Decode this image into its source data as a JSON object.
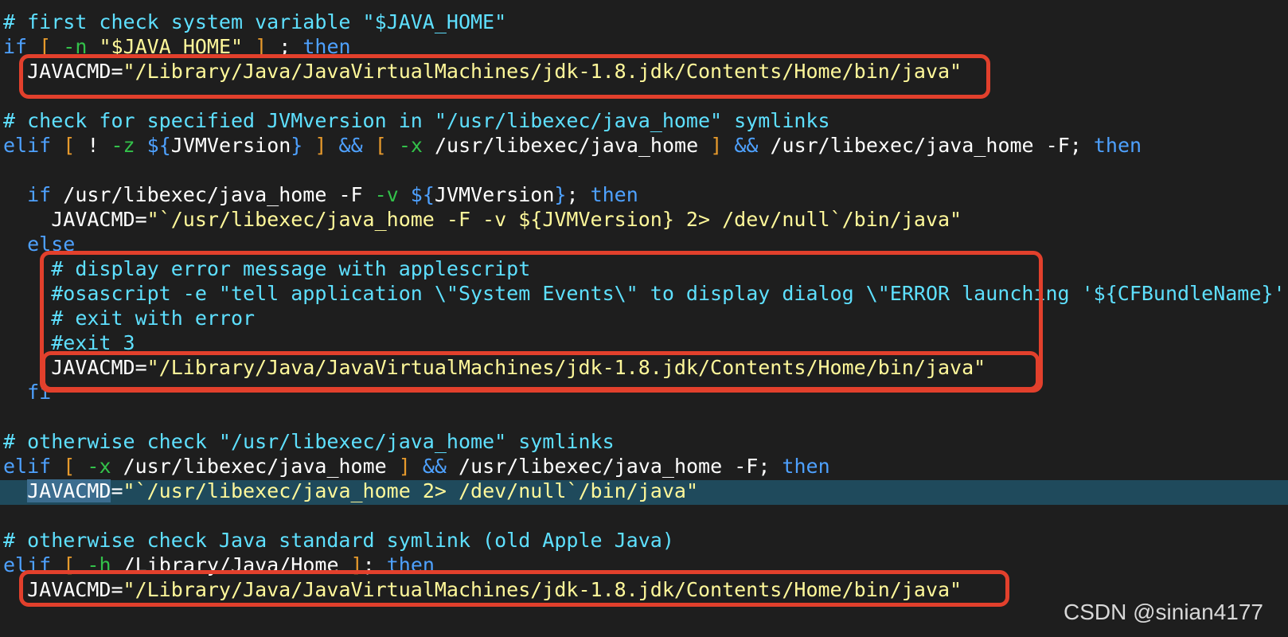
{
  "editor": {
    "lines": [
      {
        "segments": [
          {
            "t": "comment",
            "text": "# first check system variable \"$JAVA_HOME\""
          }
        ]
      },
      {
        "segments": [
          {
            "t": "kw",
            "text": "if"
          },
          {
            "t": "plain",
            "text": " "
          },
          {
            "t": "bracket",
            "text": "["
          },
          {
            "t": "plain",
            "text": " "
          },
          {
            "t": "test",
            "text": "-n"
          },
          {
            "t": "plain",
            "text": " "
          },
          {
            "t": "str",
            "text": "\"$JAVA_HOME\""
          },
          {
            "t": "plain",
            "text": " "
          },
          {
            "t": "bracket",
            "text": "]"
          },
          {
            "t": "plain",
            "text": " ; "
          },
          {
            "t": "kw",
            "text": "then"
          }
        ]
      },
      {
        "segments": [
          {
            "t": "plain",
            "text": "  JAVACMD="
          },
          {
            "t": "str",
            "text": "\"/Library/Java/JavaVirtualMachines/jdk-1.8.jdk/Contents/Home/bin/java\""
          }
        ]
      },
      {
        "segments": []
      },
      {
        "segments": [
          {
            "t": "comment",
            "text": "# check for specified JVMversion in \"/usr/libexec/java_home\" symlinks"
          }
        ]
      },
      {
        "segments": [
          {
            "t": "kw",
            "text": "elif"
          },
          {
            "t": "plain",
            "text": " "
          },
          {
            "t": "bracket",
            "text": "["
          },
          {
            "t": "plain",
            "text": " ! "
          },
          {
            "t": "test",
            "text": "-z"
          },
          {
            "t": "plain",
            "text": " "
          },
          {
            "t": "var",
            "text": "${"
          },
          {
            "t": "plain",
            "text": "JVMVersion"
          },
          {
            "t": "var",
            "text": "}"
          },
          {
            "t": "plain",
            "text": " "
          },
          {
            "t": "bracket",
            "text": "]"
          },
          {
            "t": "plain",
            "text": " "
          },
          {
            "t": "kw",
            "text": "&&"
          },
          {
            "t": "plain",
            "text": " "
          },
          {
            "t": "bracket",
            "text": "["
          },
          {
            "t": "plain",
            "text": " "
          },
          {
            "t": "test",
            "text": "-x"
          },
          {
            "t": "plain",
            "text": " /usr/libexec/java_home "
          },
          {
            "t": "bracket",
            "text": "]"
          },
          {
            "t": "plain",
            "text": " "
          },
          {
            "t": "kw",
            "text": "&&"
          },
          {
            "t": "plain",
            "text": " /usr/libexec/java_home -F; "
          },
          {
            "t": "kw",
            "text": "then"
          }
        ]
      },
      {
        "segments": []
      },
      {
        "segments": [
          {
            "t": "plain",
            "text": "  "
          },
          {
            "t": "kw",
            "text": "if"
          },
          {
            "t": "plain",
            "text": " /usr/libexec/java_home -F "
          },
          {
            "t": "test",
            "text": "-v"
          },
          {
            "t": "plain",
            "text": " "
          },
          {
            "t": "var",
            "text": "${"
          },
          {
            "t": "plain",
            "text": "JVMVersion"
          },
          {
            "t": "var",
            "text": "}"
          },
          {
            "t": "plain",
            "text": "; "
          },
          {
            "t": "kw",
            "text": "then"
          }
        ]
      },
      {
        "segments": [
          {
            "t": "plain",
            "text": "    JAVACMD="
          },
          {
            "t": "str",
            "text": "\"`/usr/libexec/java_home -F -v ${JVMVersion} 2> /dev/null`/bin/java\""
          }
        ]
      },
      {
        "segments": [
          {
            "t": "plain",
            "text": "  "
          },
          {
            "t": "kw",
            "text": "else"
          }
        ]
      },
      {
        "segments": [
          {
            "t": "plain",
            "text": "    "
          },
          {
            "t": "comment",
            "text": "# display error message with applescript"
          }
        ]
      },
      {
        "segments": [
          {
            "t": "plain",
            "text": "    "
          },
          {
            "t": "comment",
            "text": "#osascript -e \"tell application \\\"System Events\\\" to display dialog \\\"ERROR launching '${CFBundleName}'"
          }
        ]
      },
      {
        "segments": [
          {
            "t": "plain",
            "text": "    "
          },
          {
            "t": "comment",
            "text": "# exit with error"
          }
        ]
      },
      {
        "segments": [
          {
            "t": "plain",
            "text": "    "
          },
          {
            "t": "comment",
            "text": "#exit 3"
          }
        ]
      },
      {
        "segments": [
          {
            "t": "plain",
            "text": "    JAVACMD="
          },
          {
            "t": "str",
            "text": "\"/Library/Java/JavaVirtualMachines/jdk-1.8.jdk/Contents/Home/bin/java\""
          }
        ]
      },
      {
        "segments": [
          {
            "t": "plain",
            "text": "  "
          },
          {
            "t": "kw",
            "text": "fi"
          }
        ]
      },
      {
        "segments": []
      },
      {
        "segments": [
          {
            "t": "comment",
            "text": "# otherwise check \"/usr/libexec/java_home\" symlinks"
          }
        ]
      },
      {
        "segments": [
          {
            "t": "kw",
            "text": "elif"
          },
          {
            "t": "plain",
            "text": " "
          },
          {
            "t": "bracket",
            "text": "["
          },
          {
            "t": "plain",
            "text": " "
          },
          {
            "t": "test",
            "text": "-x"
          },
          {
            "t": "plain",
            "text": " /usr/libexec/java_home "
          },
          {
            "t": "bracket",
            "text": "]"
          },
          {
            "t": "plain",
            "text": " "
          },
          {
            "t": "kw",
            "text": "&&"
          },
          {
            "t": "plain",
            "text": " /usr/libexec/java_home -F; "
          },
          {
            "t": "kw",
            "text": "then"
          }
        ]
      },
      {
        "segments": [
          {
            "t": "plain",
            "text": "  "
          },
          {
            "t": "sel",
            "text": "JAVACMD"
          },
          {
            "t": "plain",
            "text": "="
          },
          {
            "t": "str",
            "text": "\"`/usr/libexec/java_home 2> /dev/null`/bin/java\""
          }
        ]
      },
      {
        "segments": []
      },
      {
        "segments": [
          {
            "t": "comment",
            "text": "# otherwise check Java standard symlink (old Apple Java)"
          }
        ]
      },
      {
        "segments": [
          {
            "t": "kw",
            "text": "elif"
          },
          {
            "t": "plain",
            "text": " "
          },
          {
            "t": "bracket",
            "text": "["
          },
          {
            "t": "plain",
            "text": " "
          },
          {
            "t": "test",
            "text": "-h"
          },
          {
            "t": "plain",
            "text": " /Library/Java/Home "
          },
          {
            "t": "bracket",
            "text": "]"
          },
          {
            "t": "plain",
            "text": "; "
          },
          {
            "t": "kw",
            "text": "then"
          }
        ]
      },
      {
        "segments": [
          {
            "t": "plain",
            "text": "  JAVACMD="
          },
          {
            "t": "str",
            "text": "\"/Library/Java/JavaVirtualMachines/jdk-1.8.jdk/Contents/Home/bin/java\""
          }
        ]
      }
    ]
  },
  "watermark": "CSDN @sinian4177",
  "colors": {
    "background": "#1e1e1e",
    "comment": "#5ee0ff",
    "keyword": "#4ea1ff",
    "string": "#fff89a",
    "test_flag": "#33c24a",
    "bracket": "#e79a2c",
    "current_line": "#1f4a5c",
    "annotation_box": "#e2402c"
  }
}
